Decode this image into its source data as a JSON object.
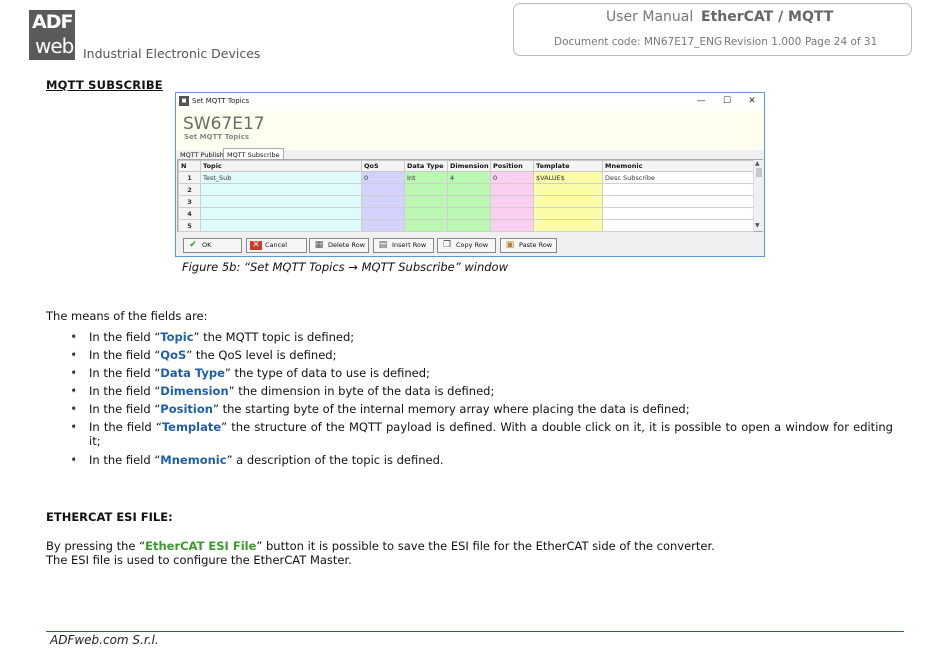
{
  "header": {
    "logo_top": "ADF",
    "logo_bottom": "web",
    "tagline": "Industrial Electronic Devices",
    "doc_type": "User Manual",
    "product": "EtherCAT / MQTT",
    "doc_code": "Document code: MN67E17_ENG",
    "revision": "Revision 1.000",
    "page": "Page 24 of 31"
  },
  "section_title": "MQTT SUBSCRIBE",
  "window": {
    "title": "Set MQTT Topics",
    "app_name": "SW67E17",
    "subtitle": "Set MQTT Topics",
    "tabs": [
      "MQTT Publish",
      "MQTT Subscribe"
    ],
    "active_tab": "MQTT Subscribe",
    "columns": [
      "N",
      "Topic",
      "QoS",
      "Data Type",
      "Dimension",
      "Position",
      "Template",
      "Mnemonic"
    ],
    "rows": [
      {
        "n": "1",
        "topic": "Test_Sub",
        "qos": "0",
        "data_type": "Int",
        "dimension": "4",
        "position": "0",
        "template": "$VALUE$",
        "mnemonic": "Desc Subscribe"
      },
      {
        "n": "2",
        "topic": "",
        "qos": "",
        "data_type": "",
        "dimension": "",
        "position": "",
        "template": "",
        "mnemonic": ""
      },
      {
        "n": "3",
        "topic": "",
        "qos": "",
        "data_type": "",
        "dimension": "",
        "position": "",
        "template": "",
        "mnemonic": ""
      },
      {
        "n": "4",
        "topic": "",
        "qos": "",
        "data_type": "",
        "dimension": "",
        "position": "",
        "template": "",
        "mnemonic": ""
      },
      {
        "n": "5",
        "topic": "",
        "qos": "",
        "data_type": "",
        "dimension": "",
        "position": "",
        "template": "",
        "mnemonic": ""
      }
    ],
    "buttons": {
      "ok": "OK",
      "cancel": "Cancel",
      "delete_row": "Delete Row",
      "insert_row": "Insert Row",
      "copy_row": "Copy Row",
      "paste_row": "Paste Row"
    }
  },
  "caption": "Figure 5b: “Set MQTT Topics → MQTT Subscribe” window",
  "intro": "The means of the fields are:",
  "fields": [
    {
      "pre": "In the field “",
      "kw": "Topic",
      "post": "” the MQTT topic is defined;"
    },
    {
      "pre": "In the field “",
      "kw": "QoS",
      "post": "” the QoS level is defined;"
    },
    {
      "pre": "In the field “",
      "kw": "Data Type",
      "post": "” the type of data to use is defined;"
    },
    {
      "pre": "In the field “",
      "kw": "Dimension",
      "post": "” the dimension in byte of the data is defined;"
    },
    {
      "pre": "In the field “",
      "kw": "Position",
      "post": "” the starting byte of the internal memory array where placing the data is defined;"
    },
    {
      "pre": "In the field “",
      "kw": "Template",
      "post": "” the structure of the MQTT payload is defined. With a double click on it, it is possible to open a window for editing it;"
    },
    {
      "pre": "In the field “",
      "kw": "Mnemonic",
      "post": "” a description of the topic is defined."
    }
  ],
  "esi": {
    "heading": "ETHERCAT ESI FILE:",
    "line1_pre": "By pressing the “",
    "line1_kw": "EtherCAT ESI File",
    "line1_post": "” button it is possible to save the ESI file for the EtherCAT side of the converter.",
    "line2": "The ESI file is used to configure the EtherCAT Master."
  },
  "footer": "ADFweb.com S.r.l.",
  "colors": {
    "keyword_blue": "#1f5fa8",
    "keyword_green": "#3a9a2c",
    "footer_rule": "#2f5d8a"
  }
}
